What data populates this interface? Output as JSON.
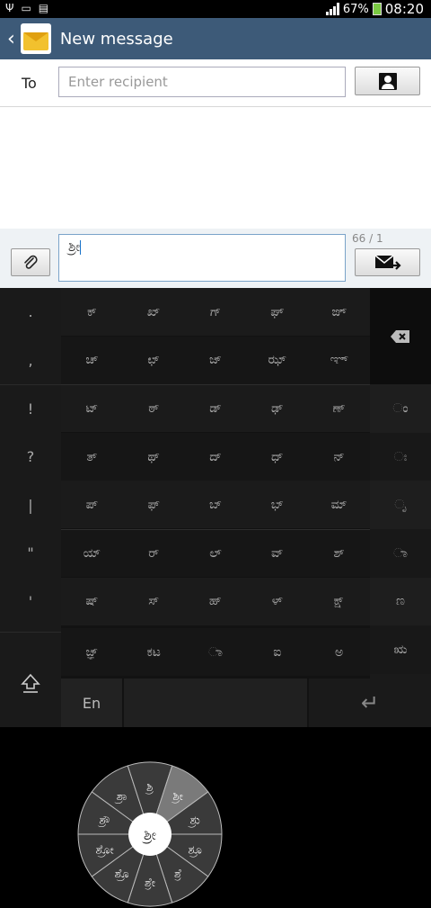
{
  "status_bar": {
    "time": "08:20",
    "battery": "67%",
    "left_icons": [
      "usb-icon",
      "keyboard-icon",
      "document-icon"
    ]
  },
  "header": {
    "title": "New message",
    "back_icon": "chevron-left-icon",
    "app_icon": "envelope-icon"
  },
  "compose": {
    "to_label": "To",
    "recipient_placeholder": "Enter recipient",
    "message_text": "ಶ್ರೀ",
    "counter": "66 / 1",
    "contact_icon": "contact-icon",
    "attach_icon": "paperclip-icon",
    "send_icon": "send-icon"
  },
  "keyboard": {
    "left_keys": [
      ".",
      ",",
      "!",
      "?",
      "|",
      "\"",
      "'"
    ],
    "right_keys": [
      "ಂ",
      "ಃ",
      "ೃ",
      "ಾ",
      "ಣ",
      "ಋ"
    ],
    "grid_rows": [
      [
        "ಕ್",
        "ಖ್",
        "ಗ್",
        "ಘ್",
        "ಙ್"
      ],
      [
        "ಚ್",
        "ಛ್",
        "ಜ್",
        "ಝ್",
        "ಞ್"
      ],
      [
        "ಟ್",
        "ಠ್",
        "ಡ್",
        "ಢ್",
        "ಣ್"
      ],
      [
        "ತ್",
        "ಥ್",
        "ದ್",
        "ಧ್",
        "ನ್"
      ],
      [
        "ಪ್",
        "ಫ್",
        "ಬ್",
        "ಭ್",
        "ಮ್"
      ],
      [
        "ಯ್",
        "ರ್",
        "ಲ್",
        "ವ್",
        "ಶ್"
      ],
      [
        "ಷ್",
        "ಸ್",
        "ಹ್",
        "ಳ್",
        "ಕ್ಷ್"
      ],
      [
        "ಜ್ಞ್",
        "ಕಟ",
        "ಾ",
        "ಐ",
        "ಅ"
      ]
    ],
    "lang_key": "En",
    "radial": {
      "center": "ಶ್ರೀ",
      "items": [
        "ಶ್ರಾ",
        "ಶ್ರಿ",
        "ಶ್ರೀ",
        "ಶ್ರು",
        "ಶ್ರೂ",
        "ಶ್ರೆ",
        "ಶ್ರೇ",
        "ಶ್ರೊ",
        "ಶ್ರೋ",
        "ಶ್ರೌ"
      ],
      "highlighted_index": 2
    }
  },
  "colors": {
    "header_bg": "#3d5a78",
    "keyboard_bg": "#121212",
    "highlight": "#7a7a7a"
  }
}
